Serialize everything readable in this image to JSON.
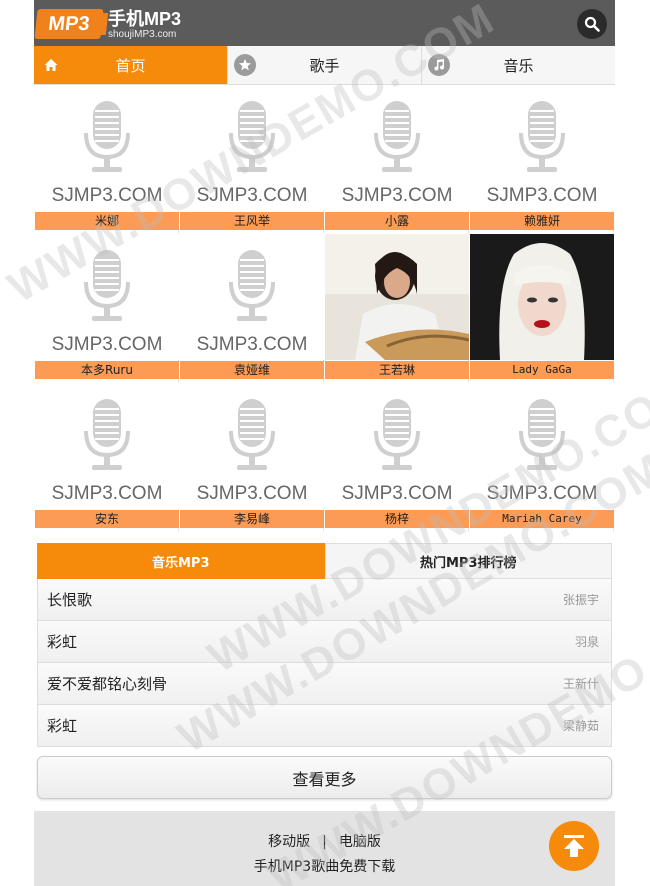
{
  "header": {
    "logo_badge": "MP3",
    "logo_title": "手机MP3",
    "logo_sub": "shoujiMP3.com"
  },
  "nav": {
    "tabs": [
      {
        "label": "首页",
        "icon": "home-icon"
      },
      {
        "label": "歌手",
        "icon": "star-icon"
      },
      {
        "label": "音乐",
        "icon": "music-note-icon"
      }
    ]
  },
  "placeholder_text": "SJMP3.COM",
  "singers": [
    {
      "name": "米娜",
      "photo": false
    },
    {
      "name": "王风举",
      "photo": false
    },
    {
      "name": "小露",
      "photo": false
    },
    {
      "name": "赖雅妍",
      "photo": false
    },
    {
      "name": "本多Ruru",
      "photo": false
    },
    {
      "name": "袁娅维",
      "photo": false
    },
    {
      "name": "王若琳",
      "photo": true
    },
    {
      "name": "Lady GaGa",
      "photo": true
    },
    {
      "name": "安东",
      "photo": false
    },
    {
      "name": "李易峰",
      "photo": false
    },
    {
      "name": "杨梓",
      "photo": false
    },
    {
      "name": "Mariah Carey",
      "photo": false
    }
  ],
  "list": {
    "tabs": [
      "音乐MP3",
      "热门MP3排行榜"
    ],
    "songs": [
      {
        "title": "长恨歌",
        "artist": "张振宇"
      },
      {
        "title": "彩虹",
        "artist": "羽泉"
      },
      {
        "title": "爱不爱都铭心刻骨",
        "artist": "王新什"
      },
      {
        "title": "彩虹",
        "artist": "梁静茹"
      }
    ],
    "more_label": "查看更多"
  },
  "footer": {
    "link_mobile": "移动版",
    "separator": "|",
    "link_pc": "电脑版",
    "copy": "手机MP3歌曲免费下载"
  },
  "watermark": "WWW.DOWNDEMO.COM",
  "colors": {
    "accent": "#f58a0b",
    "label_bg": "#fb9b56",
    "header_bg": "#5b5b5b"
  }
}
